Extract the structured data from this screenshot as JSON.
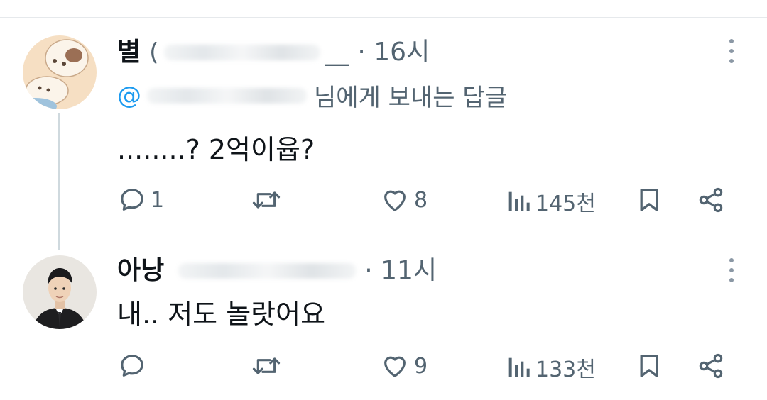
{
  "tweets": [
    {
      "name": "별",
      "handle": "(",
      "handle_tail": "__",
      "time": "· 16시",
      "reply_mention": "@",
      "reply_suffix": "님에게 보내는 답글",
      "text": "........? 2억이윱?",
      "actions": {
        "replies": "1",
        "retweets": "",
        "likes": "8",
        "views": "145천"
      }
    },
    {
      "name": "아낭",
      "handle": "",
      "time": "· 11시",
      "text": "내.. 저도 놀랏어요",
      "actions": {
        "replies": "",
        "retweets": "",
        "likes": "9",
        "views": "133천"
      }
    }
  ],
  "colors": {
    "text": "#0f1419",
    "muted": "#536471",
    "link": "#1d9bf0",
    "thread_line": "#cfd9de"
  },
  "icons": [
    "reply-icon",
    "retweet-icon",
    "like-icon",
    "views-icon",
    "bookmark-icon",
    "share-icon",
    "more-icon"
  ]
}
